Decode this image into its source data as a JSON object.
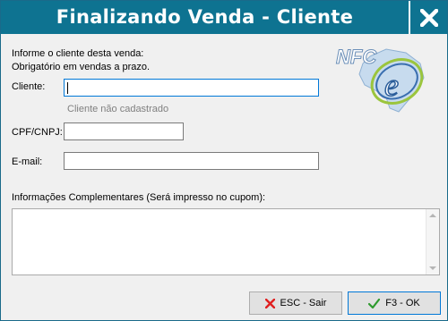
{
  "window": {
    "title": "Finalizando Venda - Cliente",
    "close_label": "X"
  },
  "form": {
    "intro_line1": "Informe o cliente desta venda:",
    "intro_line2": "Obrigatório em vendas a prazo.",
    "cliente_label": "Cliente:",
    "cliente_value": "",
    "cliente_status": "Cliente não cadastrado",
    "cpf_label": "CPF/CNPJ:",
    "cpf_value": "",
    "email_label": "E-mail:",
    "email_value": "",
    "info_label": "Informações Complementares (Será impresso no cupom):",
    "info_value": ""
  },
  "logo": {
    "text": "NFC",
    "letter": "e"
  },
  "buttons": {
    "cancel_label": "ESC - Sair",
    "ok_label": "F3 - OK"
  },
  "colors": {
    "titlebar": "#0e7391",
    "focus_border": "#0078d7",
    "cancel_icon": "#e02020",
    "ok_icon": "#2e9a2e"
  }
}
